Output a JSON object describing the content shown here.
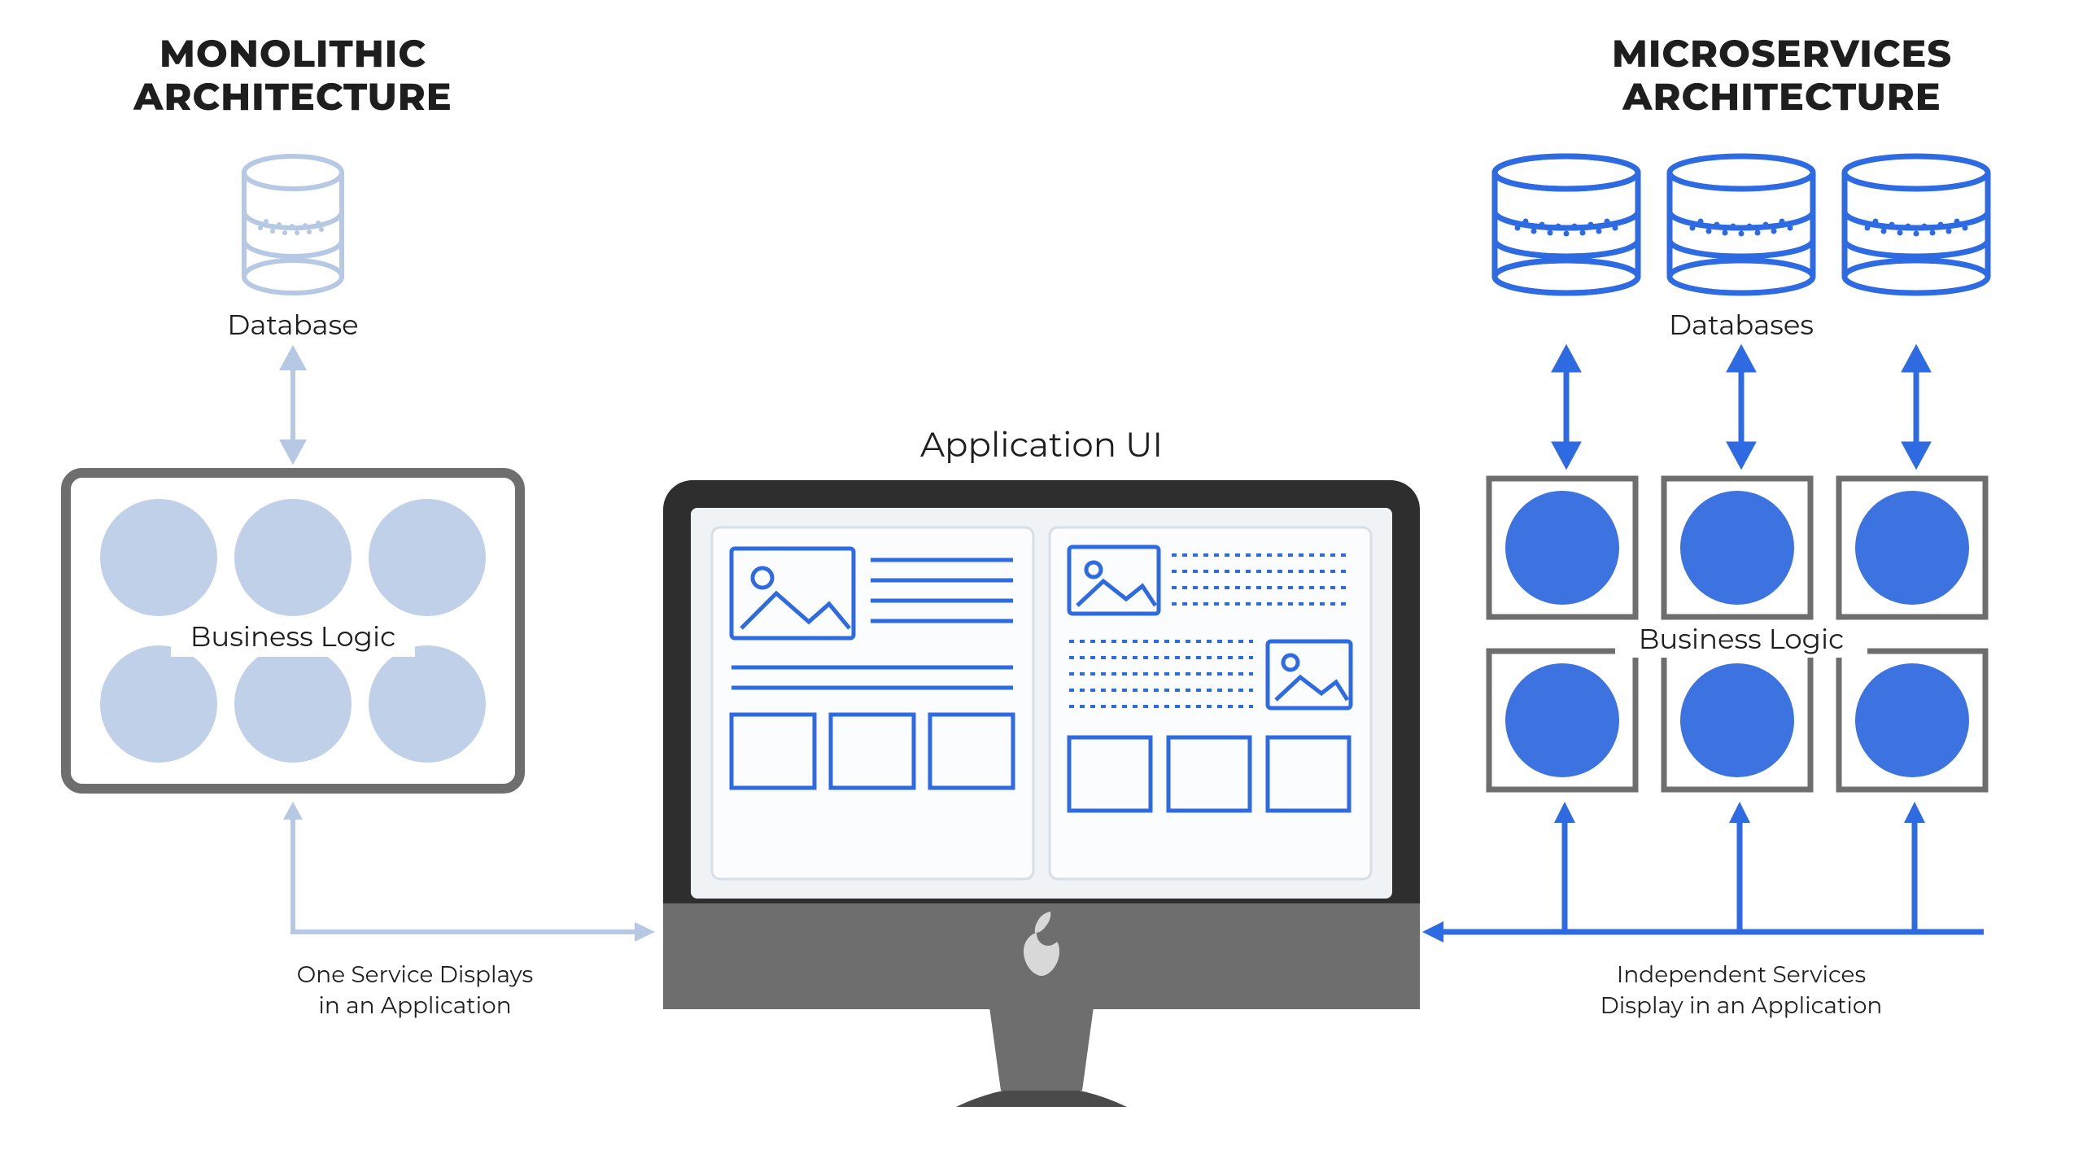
{
  "left": {
    "title_line1": "MONOLITHIC",
    "title_line2": "ARCHITECTURE",
    "db_label": "Database",
    "logic_label": "Business Logic",
    "caption_line1": "One Service Displays",
    "caption_line2": "in an Application"
  },
  "center": {
    "title": "Application UI"
  },
  "right": {
    "title_line1": "MICROSERVICES",
    "title_line2": "ARCHITECTURE",
    "db_label": "Databases",
    "logic_label": "Business Logic",
    "caption_line1": "Independent Services",
    "caption_line2": "Display in an Application"
  },
  "diagram": {
    "type": "architecture-comparison",
    "sides": [
      {
        "name": "Monolithic",
        "databases": 1,
        "business_logic_services": 6,
        "services_container": "single-block",
        "flow": "Database <-> Business Logic -> Application UI",
        "caption": "One Service Displays in an Application",
        "color": "light-blue"
      },
      {
        "name": "Microservices",
        "databases": 3,
        "business_logic_services": 6,
        "services_container": "separate-blocks",
        "flow": "Databases <-> Business Logic <- Application UI (per service)",
        "caption": "Independent Services Display in an Application",
        "color": "blue"
      }
    ],
    "center": "Application UI (desktop computer with wireframe mockups)"
  }
}
